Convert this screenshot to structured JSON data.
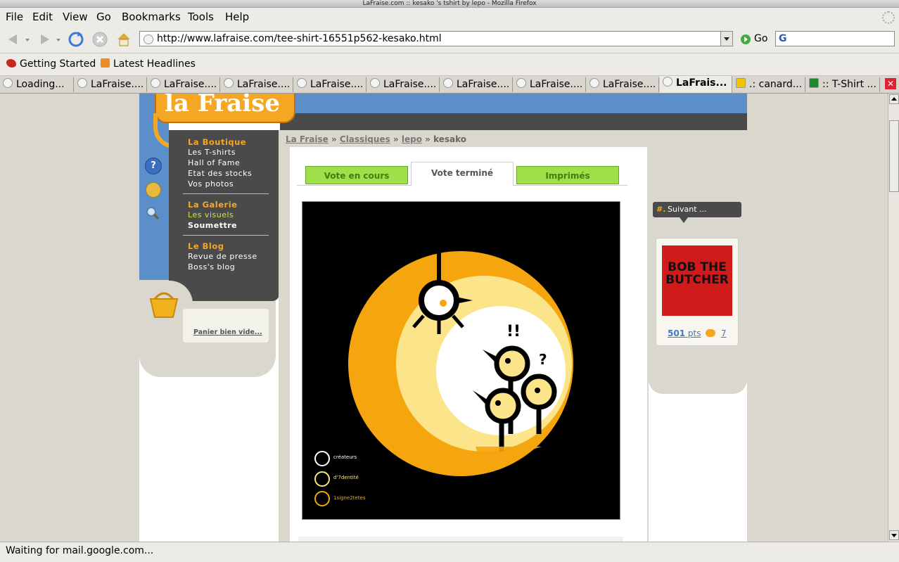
{
  "window": {
    "title": "LaFraise.com :: kesako 's tshirt by lepo - Mozilla Firefox"
  },
  "menu": [
    "File",
    "Edit",
    "View",
    "Go",
    "Bookmarks",
    "Tools",
    "Help"
  ],
  "toolbar": {
    "url": "http://www.lafraise.com/tee-shirt-16551p562-kesako.html",
    "go_label": "Go"
  },
  "bookmarks": [
    "Getting Started",
    "Latest Headlines"
  ],
  "tabs": [
    "Loading...",
    "LaFraise....",
    "LaFraise....",
    "LaFraise....",
    "LaFraise....",
    "LaFraise....",
    "LaFraise....",
    "LaFraise....",
    "LaFraise....",
    "LaFrais...",
    ".: canard...",
    ":: T-Shirt ..."
  ],
  "sidebar": {
    "logo": "la Fraise",
    "boutique_title": "La Boutique",
    "boutique_items": [
      "Les T-shirts",
      "Hall of Fame",
      "Etat des stocks",
      "Vos photos"
    ],
    "galerie_title": "La Galerie",
    "galerie_items": [
      "Les visuels",
      "Soumettre"
    ],
    "blog_title": "Le Blog",
    "blog_items": [
      "Revue de presse",
      "Boss's blog"
    ],
    "cart_text": "Panier bien vide..."
  },
  "breadcrumb": {
    "home": "La Fraise",
    "category": "Classiques",
    "author": "lepo",
    "current": "kesako"
  },
  "vote_tabs": {
    "in_progress": "Vote en cours",
    "done": "Vote terminé",
    "printed": "Imprimés"
  },
  "artwork": {
    "exclaim": "!!",
    "question": "?",
    "credits": [
      "créateurs",
      "d'7dentité",
      "1signe2tetes"
    ]
  },
  "next_panel": {
    "header": "Suivant ...",
    "thumb_text": "BOB THE BUTCHER",
    "points": "501",
    "points_label": "pts",
    "comments": "7"
  },
  "status": {
    "text": "Waiting for mail.google.com..."
  },
  "colors": {
    "orange": "#f5a623",
    "green": "#9ee04a",
    "dark": "#4a4a4a",
    "blue": "#5b8fc9"
  }
}
